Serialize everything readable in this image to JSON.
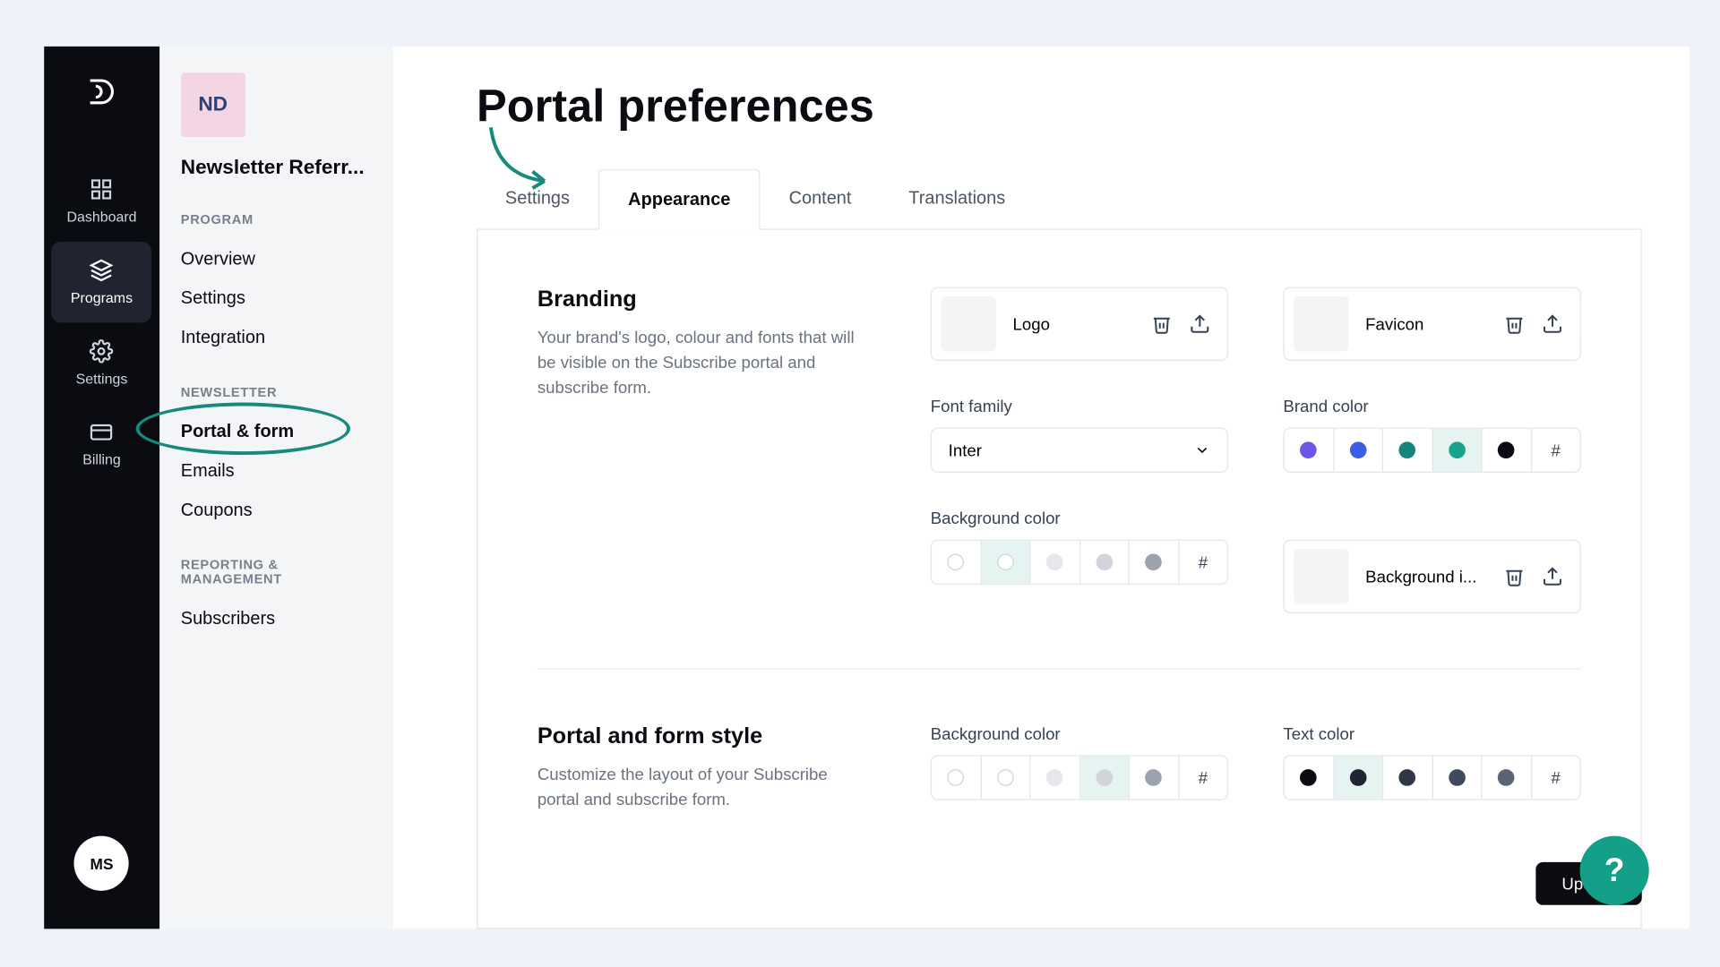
{
  "rail": {
    "items": [
      "Dashboard",
      "Programs",
      "Settings",
      "Billing"
    ],
    "active_index": 1,
    "user_initials": "MS"
  },
  "sidebar": {
    "chip": "ND",
    "program_title": "Newsletter Referr...",
    "groups": [
      {
        "label": "PROGRAM",
        "items": [
          "Overview",
          "Settings",
          "Integration"
        ],
        "active_index": -1
      },
      {
        "label": "NEWSLETTER",
        "items": [
          "Portal & form",
          "Emails",
          "Coupons"
        ],
        "active_index": 0
      },
      {
        "label": "REPORTING & MANAGEMENT",
        "items": [
          "Subscribers"
        ],
        "active_index": -1
      }
    ]
  },
  "page": {
    "title": "Portal preferences",
    "tabs": [
      "Settings",
      "Appearance",
      "Content",
      "Translations"
    ],
    "active_tab": 1,
    "update_label": "Update"
  },
  "branding": {
    "title": "Branding",
    "desc": "Your brand's logo, colour and fonts that will be visible on the Subscribe portal and subscribe form.",
    "logo_label": "Logo",
    "favicon_label": "Favicon",
    "font_label": "Font family",
    "font_value": "Inter",
    "brand_color_label": "Brand color",
    "brand_colors": [
      "#6e56e6",
      "#3b5fe2",
      "#17857b",
      "#19a38c",
      "#0a0c12"
    ],
    "brand_selected": 3,
    "bg_color_label": "Background color",
    "bg_swatches": [
      "hollow",
      "#ffffff",
      "#e5e7eb",
      "#d1d5db",
      "#9ca3af"
    ],
    "bg_selected": 1,
    "bg_image_label": "Background i..."
  },
  "style": {
    "title": "Portal and form style",
    "desc": "Customize the layout of your Subscribe portal and subscribe form.",
    "bg_color_label": "Background color",
    "bg_swatches": [
      "hollow",
      "#ffffff",
      "#e5e7eb",
      "#d1d5db",
      "#9ca3af"
    ],
    "bg_selected": 3,
    "text_color_label": "Text color",
    "text_swatches": [
      "#0a0c12",
      "#1f2533",
      "#2e3647",
      "#414a5c",
      "#5a6475"
    ],
    "text_selected": 1
  },
  "help": "?"
}
